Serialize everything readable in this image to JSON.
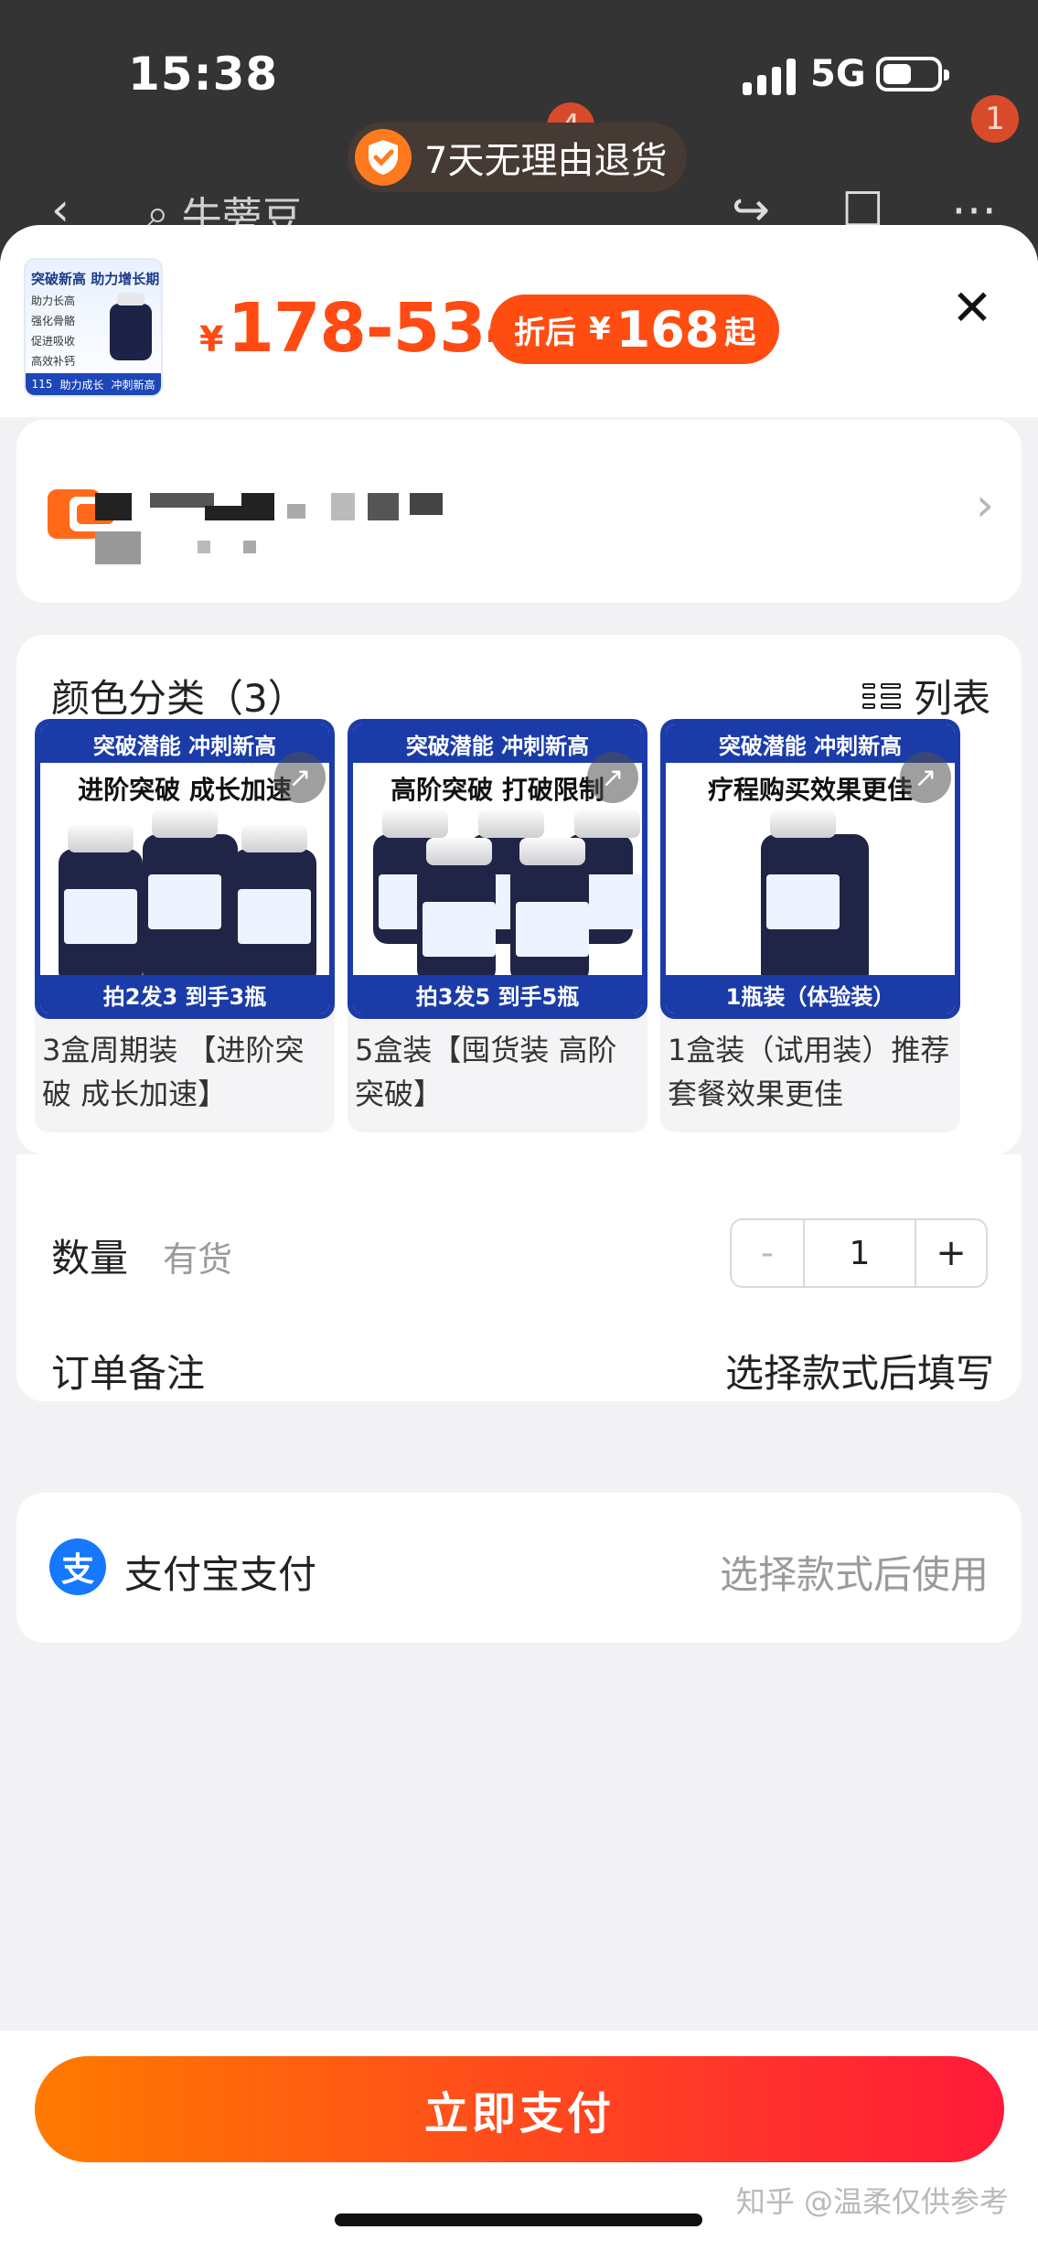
{
  "status_bar": {
    "time": "15:38",
    "network": "5G"
  },
  "return_badge": {
    "text": "7天无理由退货"
  },
  "nav": {
    "search_text": "牛蒡豆",
    "cart_badge": "4",
    "more_badge": "1"
  },
  "product": {
    "thumb": {
      "title": "突破新高 助力增长期",
      "lines": [
        "助力长高",
        "强化骨骼",
        "促进吸收",
        "高效补钙"
      ],
      "band_left": "助力成长",
      "band_right": "冲刺新高",
      "count": "115"
    },
    "price_currency": "¥",
    "price_range": "178-534",
    "after_label": "折后",
    "after_currency": "¥",
    "after_price": "168",
    "after_suffix": "起"
  },
  "sku": {
    "title": "颜色分类（3）",
    "list_toggle": "列表",
    "items": [
      {
        "banner": "突破潜能 冲刺新高",
        "headline": "进阶突破 成长加速",
        "footer": "拍2发3 到手3瓶",
        "label": "3盒周期装 【进阶突破 成长加速】"
      },
      {
        "banner": "突破潜能 冲刺新高",
        "headline": "高阶突破 打破限制",
        "footer": "拍3发5 到手5瓶",
        "label": "5盒装【囤货装 高阶突破】"
      },
      {
        "banner": "突破潜能 冲刺新高",
        "headline": "疗程购买效果更佳",
        "footer": "1瓶装（体验装）",
        "label": "1盒装（试用装）推荐套餐效果更佳"
      }
    ]
  },
  "quantity": {
    "label": "数量",
    "stock": "有货",
    "value": "1",
    "minus": "-",
    "plus": "+"
  },
  "order_note": {
    "label": "订单备注",
    "hint": "选择款式后填写"
  },
  "payment": {
    "label": "支付宝支付",
    "hint": "选择款式后使用",
    "icon_glyph": "支"
  },
  "pay_button": {
    "label": "立即支付"
  },
  "watermark": "知乎 @温柔仅供参考",
  "colors": {
    "accent": "#ff4a14",
    "button_start": "#ff7a00",
    "button_end": "#ff1a3a",
    "alipay": "#1677ff"
  }
}
